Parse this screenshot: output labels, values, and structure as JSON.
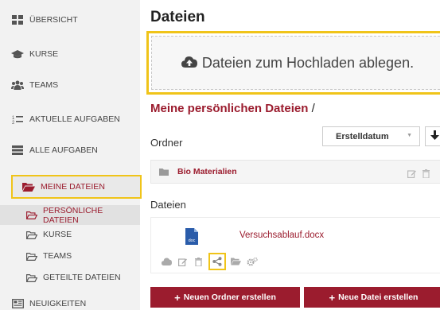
{
  "colors": {
    "accent": "#9b1c2e",
    "highlight": "#f0c419",
    "sidebar_bg": "#f2f2f2"
  },
  "sidebar": {
    "items": [
      {
        "label": "Übersicht",
        "icon": "dashboard-icon"
      },
      {
        "label": "Kurse",
        "icon": "graduation-cap-icon"
      },
      {
        "label": "Teams",
        "icon": "users-icon"
      },
      {
        "label": "Aktuelle Aufgaben",
        "icon": "task-list-icon"
      },
      {
        "label": "Alle Aufgaben",
        "icon": "tasks-icon"
      },
      {
        "label": "Meine Dateien",
        "icon": "folder-open-icon"
      }
    ],
    "sub_items": [
      {
        "label": "Persönliche Dateien",
        "icon": "folder-outline-icon"
      },
      {
        "label": "Kurse",
        "icon": "folder-outline-icon"
      },
      {
        "label": "Teams",
        "icon": "folder-outline-icon"
      },
      {
        "label": "Geteilte Dateien",
        "icon": "folder-outline-icon"
      }
    ],
    "last_item": {
      "label": "Neuigkeiten",
      "icon": "newspaper-icon"
    }
  },
  "main": {
    "title": "Dateien",
    "dropzone_text": "Dateien zum Hochladen ablegen.",
    "section_title": "Meine persönlichen Dateien",
    "section_slash": "/",
    "ordner_label": "Ordner",
    "sort_value": "Erstelldatum",
    "folders": [
      {
        "name": "Bio Materialien"
      }
    ],
    "dateien_label": "Dateien",
    "files": [
      {
        "name": "Versuchsablauf.docx",
        "type_label": "doc"
      }
    ],
    "buttons": {
      "new_folder": "Neuen Ordner erstellen",
      "new_file": "Neue Datei erstellen"
    }
  }
}
